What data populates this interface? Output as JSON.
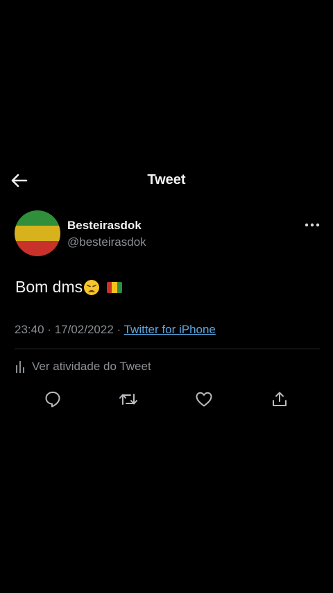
{
  "header": {
    "title": "Tweet"
  },
  "author": {
    "name": "Besteirasdok",
    "handle": "@besteirasdok",
    "avatar_colors": [
      "#2f8f3a",
      "#d8b21c",
      "#c8322a"
    ]
  },
  "tweet": {
    "text": "Bom dms",
    "emoji": "weary-face",
    "flag_colors": [
      "#c8322a",
      "#f2c21b",
      "#2f8f3a"
    ],
    "time": "23:40",
    "separator": "·",
    "date": "17/02/2022",
    "source": "Twitter for iPhone"
  },
  "activity": {
    "label": "Ver atividade do Tweet"
  },
  "colors": {
    "background": "#000000",
    "secondary": "#8b8f94",
    "link": "#5aa7e0"
  },
  "actions": [
    "reply-icon",
    "retweet-icon",
    "like-icon",
    "share-icon"
  ]
}
